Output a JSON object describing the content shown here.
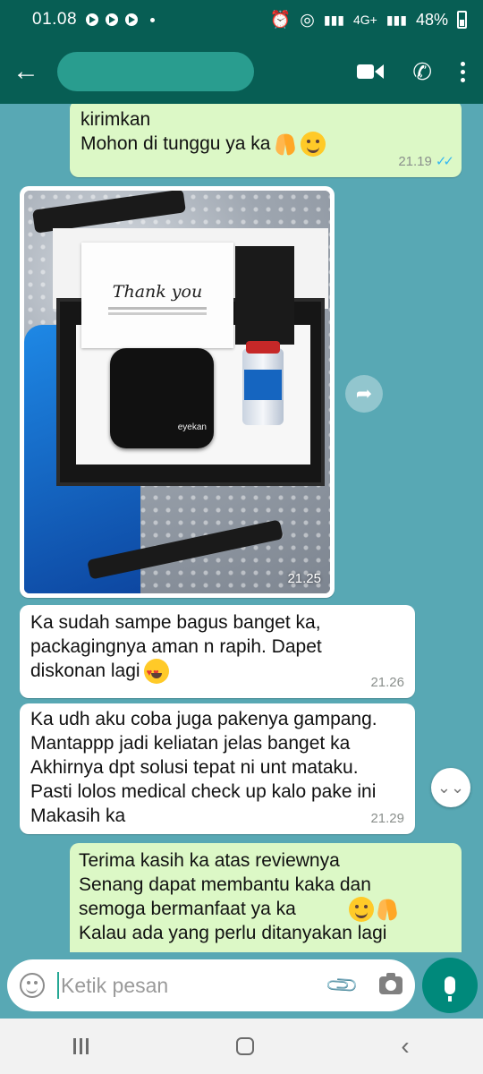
{
  "status_bar": {
    "time": "01.08",
    "network": "4G+",
    "battery": "48%"
  },
  "header": {
    "contact_name": ""
  },
  "messages": [
    {
      "direction": "outgoing",
      "text": "kirimkan\nMohon di tunggu ya ka",
      "emojis": [
        "folded-hands",
        "smiling-face"
      ],
      "time": "21.19",
      "status": "read"
    },
    {
      "direction": "incoming",
      "type": "image",
      "image_caption_text": "Thank you",
      "product_brand": "eyekan",
      "time": "21.25"
    },
    {
      "direction": "incoming",
      "text": "Ka sudah sampe bagus banget ka,\npackagingnya aman n rapih. Dapet\ndiskonan lagi",
      "emojis": [
        "heart-eyes"
      ],
      "time": "21.26"
    },
    {
      "direction": "incoming",
      "text": "Ka udh aku coba juga pakenya gampang.\nMantappp jadi keliatan jelas banget ka\nAkhirnya dpt solusi tepat ni unt mataku.\nPasti lolos medical check up kalo pake ini\nMakasih ka",
      "time": "21.29"
    },
    {
      "direction": "outgoing",
      "text": "Terima kasih ka atas reviewnya\nSenang dapat membantu kaka dan\nsemoga bermanfaat ya ka\nKalau ada yang perlu ditanyakan lagi",
      "emojis": [
        "smiling-face",
        "folded-hands"
      ],
      "time": ""
    }
  ],
  "input": {
    "placeholder": "Ketik pesan"
  },
  "colors": {
    "header": "#075e54",
    "outgoing_bubble": "#dcf8c6",
    "incoming_bubble": "#ffffff",
    "chat_background": "#58a8b4",
    "mic_button": "#00897b",
    "read_ticks": "#34b7f1"
  },
  "icons": [
    "back-arrow-icon",
    "video-call-icon",
    "voice-call-icon",
    "more-options-icon",
    "forward-icon",
    "scroll-down-icon",
    "emoji-icon",
    "attach-icon",
    "camera-icon",
    "mic-icon",
    "nav-recent-icon",
    "nav-home-icon",
    "nav-back-icon"
  ]
}
